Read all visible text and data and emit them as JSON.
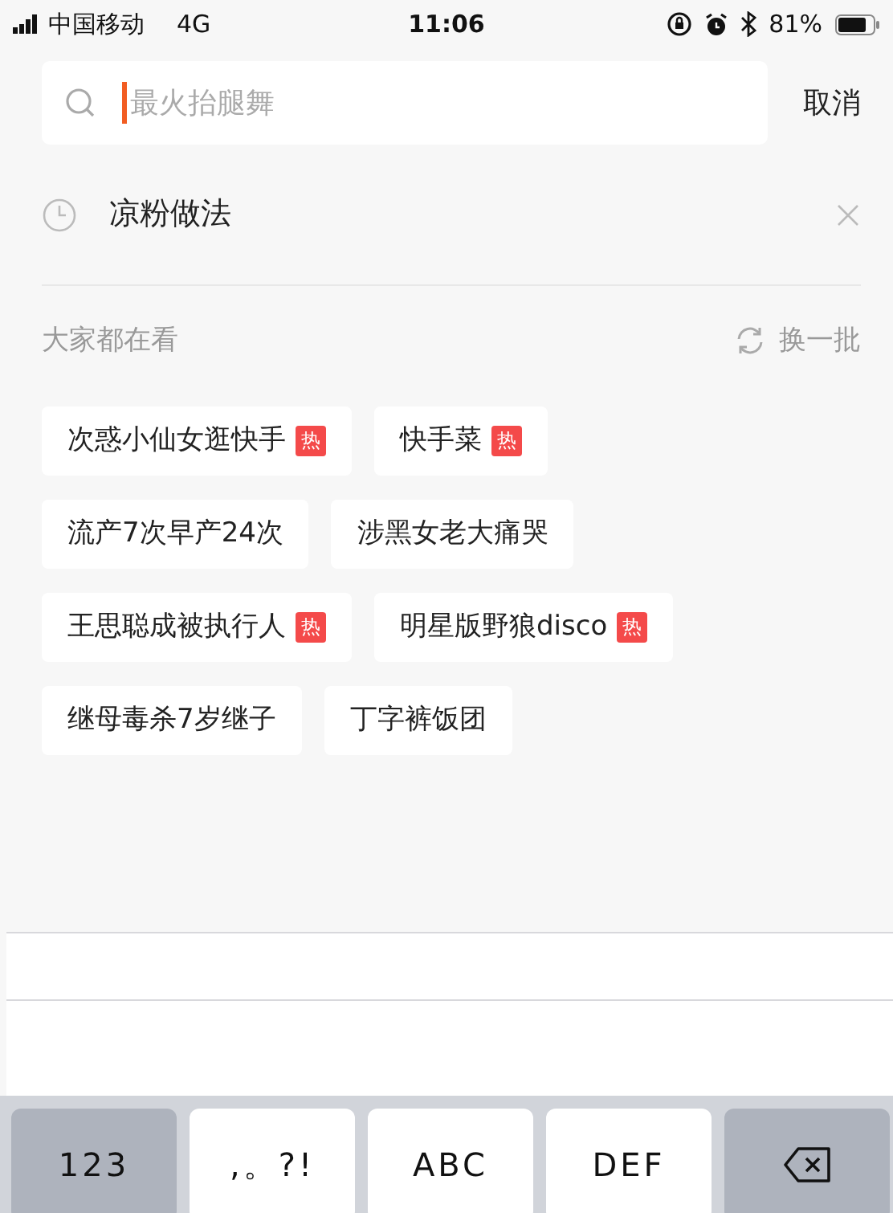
{
  "status_bar": {
    "carrier": "中国移动",
    "network": "4G",
    "time": "11:06",
    "battery": "81%"
  },
  "search": {
    "placeholder": "最火抬腿舞",
    "cancel": "取消"
  },
  "history": [
    {
      "text": "凉粉做法"
    }
  ],
  "trending": {
    "title": "大家都在看",
    "refresh": "换一批",
    "tags": [
      {
        "text": "次惑小仙女逛快手",
        "hot": true,
        "badge": "热"
      },
      {
        "text": "快手菜",
        "hot": true,
        "badge": "热"
      },
      {
        "text": "流产7次早产24次",
        "hot": false
      },
      {
        "text": "涉黑女老大痛哭",
        "hot": false
      },
      {
        "text": "王思聪成被执行人",
        "hot": true,
        "badge": "热"
      },
      {
        "text": "明星版野狼disco",
        "hot": true,
        "badge": "热"
      },
      {
        "text": "继母毒杀7岁继子",
        "hot": false
      },
      {
        "text": "丁字裤饭团",
        "hot": false
      }
    ]
  },
  "keyboard": {
    "keys": [
      {
        "label": "123",
        "kind": "function"
      },
      {
        "label": ",。?!",
        "kind": "letter"
      },
      {
        "label": "ABC",
        "kind": "letter"
      },
      {
        "label": "DEF",
        "kind": "letter"
      },
      {
        "kind": "delete"
      }
    ]
  }
}
